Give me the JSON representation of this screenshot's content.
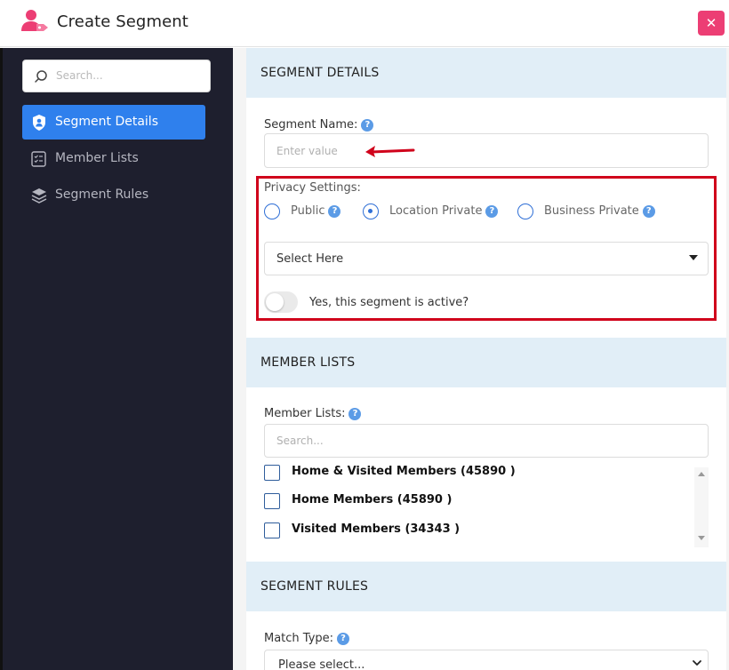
{
  "header": {
    "title": "Create Segment",
    "close_label": "✕"
  },
  "colors": {
    "accent": "#2f80ed",
    "brand_pink": "#ec3e74",
    "sidebar_bg": "#1e1f2e",
    "highlight_red": "#d0021b"
  },
  "sidebar": {
    "search_placeholder": "Search...",
    "items": [
      {
        "label": "Segment Details",
        "icon": "shield-people-icon",
        "active": true
      },
      {
        "label": "Member Lists",
        "icon": "list-check-icon",
        "active": false
      },
      {
        "label": "Segment Rules",
        "icon": "layers-icon",
        "active": false
      }
    ]
  },
  "segment_details": {
    "heading": "SEGMENT DETAILS",
    "name_label": "Segment Name:",
    "name_placeholder": "Enter value",
    "name_value": "",
    "privacy_label": "Privacy Settings:",
    "privacy_options": [
      {
        "label": "Public",
        "checked": false
      },
      {
        "label": "Location Private",
        "checked": true
      },
      {
        "label": "Business Private",
        "checked": false
      }
    ],
    "select_value": "Select Here",
    "active_label": "Yes, this segment is active?",
    "active": false
  },
  "member_lists": {
    "heading": "MEMBER LISTS",
    "label": "Member Lists:",
    "search_placeholder": "Search...",
    "items": [
      {
        "label": "Home & Visited Members (45890 )",
        "checked": false
      },
      {
        "label": "Home Members (45890 )",
        "checked": false
      },
      {
        "label": "Visited Members (34343 )",
        "checked": false
      }
    ]
  },
  "segment_rules": {
    "heading": "SEGMENT RULES",
    "match_label": "Match Type:",
    "match_value": "Please select..."
  },
  "help_glyph": "?"
}
